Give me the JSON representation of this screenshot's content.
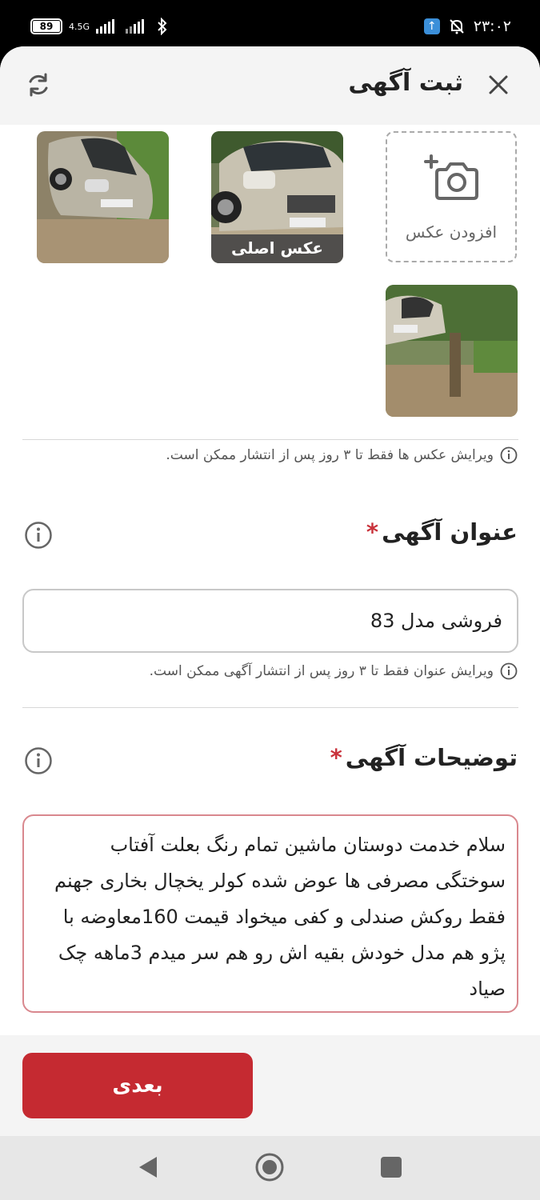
{
  "status_bar": {
    "battery": "89",
    "network": "4.5G",
    "time": "۲۳:۰۲"
  },
  "header": {
    "title": "ثبت آگهی",
    "close_icon": "close-icon",
    "refresh_icon": "refresh-icon"
  },
  "photos": {
    "add_label": "افزودن عکس",
    "main_tag": "عکس اصلی",
    "edit_note": "ویرایش عکس ها فقط تا ۳ روز پس از انتشار ممکن است."
  },
  "title_section": {
    "label": "عنوان آگهی",
    "required_mark": "*",
    "value": "فروشی مدل 83",
    "edit_note": "ویرایش عنوان فقط تا ۳ روز پس از انتشار آگهی ممکن است."
  },
  "description_section": {
    "label": "توضیحات آگهی",
    "required_mark": "*",
    "value": "سلام خدمت دوستان ماشین تمام رنگ بعلت آفتاب سوختگی مصرفی ها عوض شده کولر یخچال بخاری جهنم فقط روکش صندلی و کفی میخواد قیمت 160معاوضه با پژو هم مدل خودش بقیه اش رو هم سر میدم 3ماهه چک صیاد"
  },
  "footer": {
    "next_label": "بعدی"
  },
  "colors": {
    "accent": "#c52a31",
    "required": "#c9323b"
  }
}
